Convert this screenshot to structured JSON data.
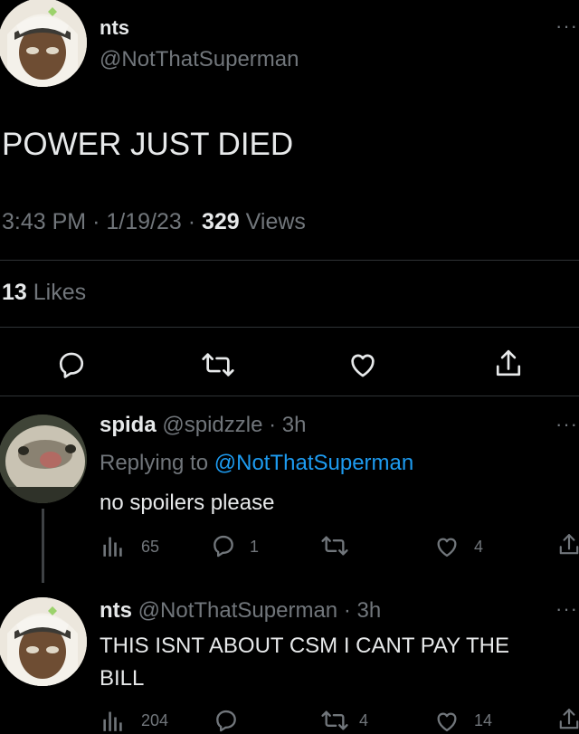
{
  "main_tweet": {
    "display_name": "nts",
    "handle": "@NotThatSuperman",
    "text": "POWER JUST DIED",
    "time": "3:43 PM",
    "date": "1/19/23",
    "dot": "·",
    "views_count": "329",
    "views_label": "Views",
    "likes_count": "13",
    "likes_label": "Likes"
  },
  "more_glyph": "···",
  "reply1": {
    "display_name": "spida",
    "handle": "@spidzzle",
    "time": "· 3h",
    "replying_prefix": "Replying to",
    "replying_handle": "@NotThatSuperman",
    "text": "no spoilers please",
    "stats": {
      "views": "65",
      "replies": "1",
      "retweets": "",
      "likes": "4"
    }
  },
  "reply2": {
    "display_name": "nts",
    "handle": "@NotThatSuperman",
    "time": "· 3h",
    "text_line1": "THIS ISNT ABOUT CSM I CANT PAY THE",
    "text_line2": "BILL",
    "stats": {
      "views": "204",
      "replies": "",
      "retweets": "4",
      "likes": "14"
    }
  },
  "colors": {
    "background": "#000000",
    "text": "#e7e9ea",
    "muted": "#71767b",
    "link": "#1d9bf0",
    "divider": "#2f3336"
  }
}
